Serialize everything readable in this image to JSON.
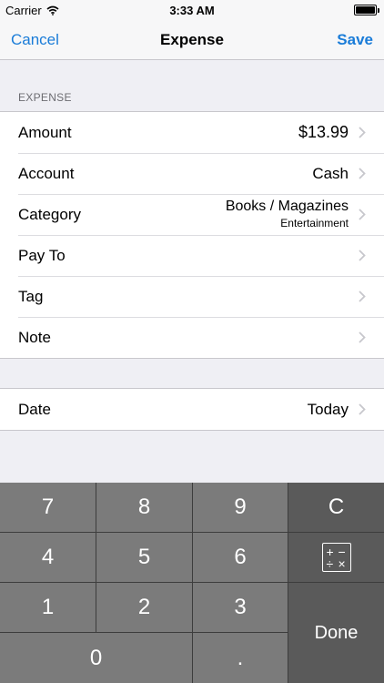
{
  "status": {
    "carrier": "Carrier",
    "time": "3:33 AM"
  },
  "nav": {
    "cancel": "Cancel",
    "title": "Expense",
    "save": "Save"
  },
  "section": {
    "header": "EXPENSE"
  },
  "rows": {
    "amount": {
      "label": "Amount",
      "value": "$13.99"
    },
    "account": {
      "label": "Account",
      "value": "Cash"
    },
    "category": {
      "label": "Category",
      "value": "Books / Magazines",
      "sub": "Entertainment"
    },
    "payto": {
      "label": "Pay To",
      "value": ""
    },
    "tag": {
      "label": "Tag",
      "value": ""
    },
    "note": {
      "label": "Note",
      "value": ""
    },
    "date": {
      "label": "Date",
      "value": "Today"
    }
  },
  "keypad": {
    "k7": "7",
    "k8": "8",
    "k9": "9",
    "clear": "C",
    "k4": "4",
    "k5": "5",
    "k6": "6",
    "k1": "1",
    "k2": "2",
    "k3": "3",
    "done": "Done",
    "k0": "0",
    "dot": ".",
    "calc_icon": "calculator-operators-icon",
    "calc_glyphs": {
      "plus": "+",
      "minus": "−",
      "divide": "÷",
      "times": "×"
    }
  },
  "colors": {
    "accent": "#1a7cd8",
    "key": "#7b7b7b",
    "key_dark": "#5a5a5a",
    "background": "#efeff4"
  }
}
